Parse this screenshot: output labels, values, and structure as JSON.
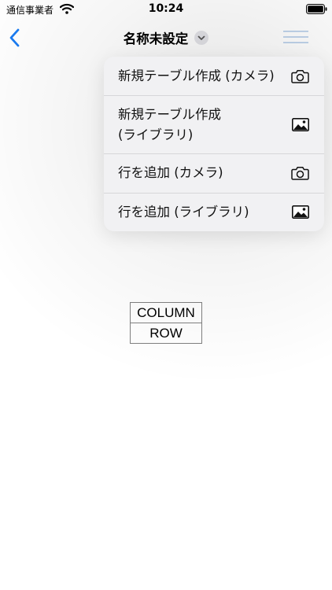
{
  "status_bar": {
    "carrier": "通信事業者",
    "time": "10:24"
  },
  "nav": {
    "title": "名称未設定",
    "back_icon": "chevron-left-icon",
    "menu_icon": "hamburger-icon",
    "accent_color": "#1a7cf2"
  },
  "menu": {
    "items": [
      {
        "line1": "新規テーブル作成 (カメラ)",
        "line2": "",
        "icon": "camera-icon"
      },
      {
        "line1": "新規テーブル作成",
        "line2": "(ライブラリ)",
        "icon": "photo-icon"
      },
      {
        "line1": "行を追加 (カメラ)",
        "line2": "",
        "icon": "camera-icon"
      },
      {
        "line1": "行を追加 (ライブラリ)",
        "line2": "",
        "icon": "photo-icon"
      }
    ]
  },
  "table": {
    "header": "COLUMN",
    "row": "ROW"
  }
}
